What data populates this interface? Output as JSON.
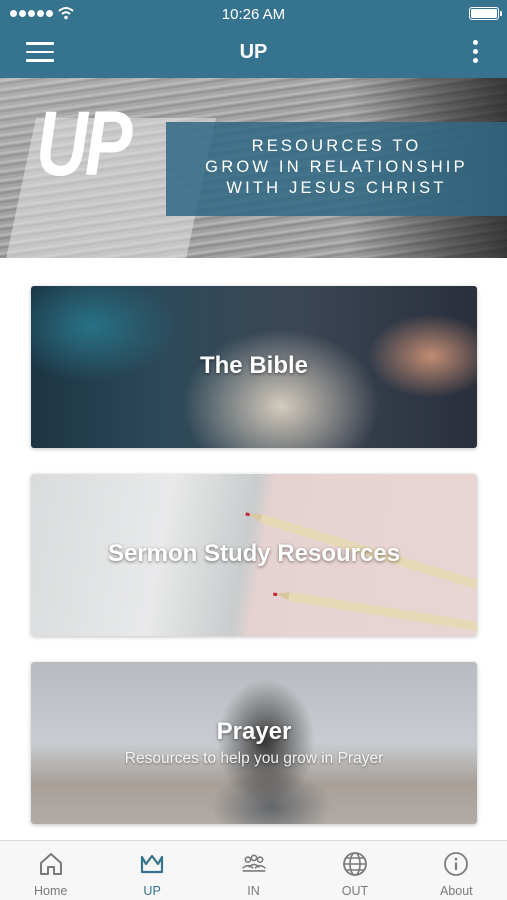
{
  "status_bar": {
    "time": "10:26 AM",
    "signal_icon": "cellular-signal-icon",
    "wifi_icon": "wifi-icon",
    "battery_icon": "battery-icon",
    "battery_level": 1.0
  },
  "nav": {
    "title": "UP",
    "menu_icon": "hamburger-menu-icon",
    "more_icon": "vertical-dots-icon",
    "color": "#35738f"
  },
  "hero": {
    "logo": "UP",
    "lines": [
      "RESOURCES TO",
      "GROW IN RELATIONSHIP",
      "WITH JESUS CHRIST"
    ]
  },
  "cards": [
    {
      "title": "The Bible",
      "subtitle": ""
    },
    {
      "title": "Sermon Study Resources",
      "subtitle": ""
    },
    {
      "title": "Prayer",
      "subtitle": "Resources to help you grow in Prayer"
    }
  ],
  "tabs": [
    {
      "label": "Home",
      "icon": "home-icon",
      "active": false
    },
    {
      "label": "UP",
      "icon": "crown-icon",
      "active": true
    },
    {
      "label": "IN",
      "icon": "people-group-icon",
      "active": false
    },
    {
      "label": "OUT",
      "icon": "globe-icon",
      "active": false
    },
    {
      "label": "About",
      "icon": "info-icon",
      "active": false
    }
  ],
  "colors": {
    "accent": "#35738f",
    "tab_inactive": "#7a7a7a"
  }
}
